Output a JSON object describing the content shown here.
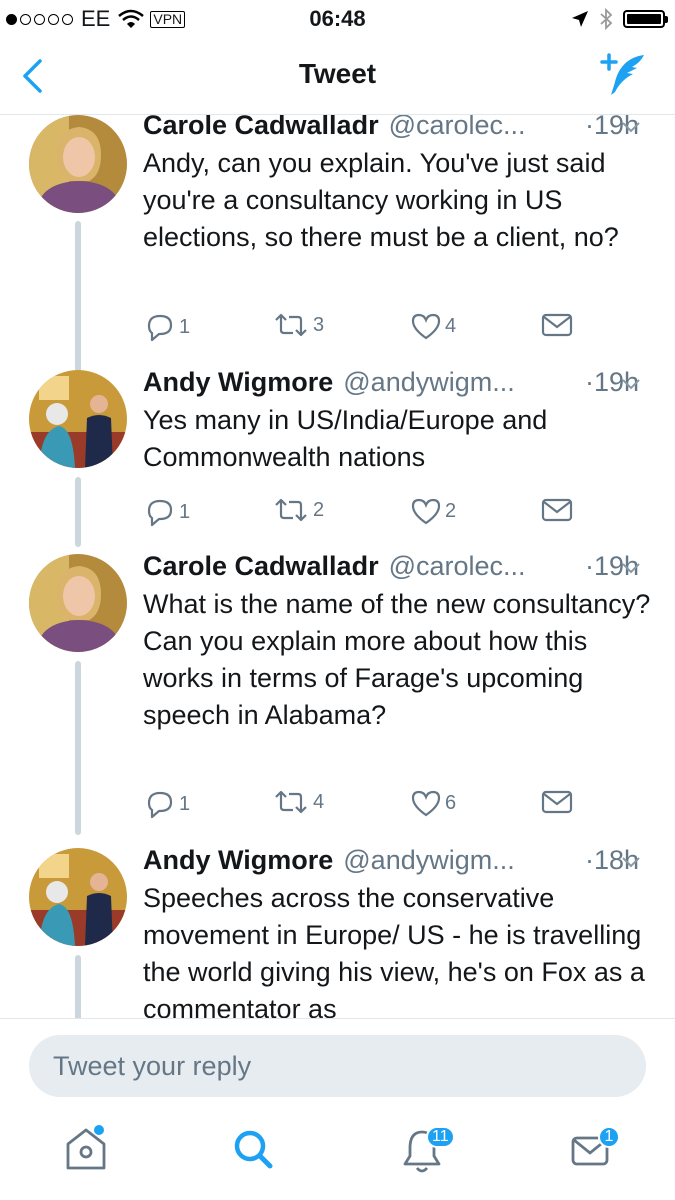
{
  "status_bar": {
    "carrier": "EE",
    "vpn": "VPN",
    "time": "06:48"
  },
  "nav": {
    "title": "Tweet"
  },
  "tweets": [
    {
      "name": "Carole Cadwalladr",
      "handle": "@carolec...",
      "time": "·19h",
      "text": "Andy, can you explain. You've just said you're a consultancy working in US elections, so there must be a client, no?",
      "replies": "1",
      "retweets": "3",
      "likes": "4"
    },
    {
      "name": "Andy Wigmore",
      "handle": "@andywigm...",
      "time": "·19h",
      "text": "Yes many in US/India/Europe and Commonwealth nations",
      "replies": "1",
      "retweets": "2",
      "likes": "2"
    },
    {
      "name": "Carole Cadwalladr",
      "handle": "@carolec...",
      "time": "·19h",
      "text": "What is the name of the new consultancy?\nCan you explain more about how this works in terms of Farage's upcoming speech in Alabama?",
      "replies": "1",
      "retweets": "4",
      "likes": "6"
    },
    {
      "name": "Andy Wigmore",
      "handle": "@andywigm...",
      "time": "·18h",
      "text": "Speeches across the conservative movement in Europe/ US - he is travelling the world giving his view, he's on Fox as a commentator as",
      "replies": "",
      "retweets": "",
      "likes": ""
    }
  ],
  "reply": {
    "placeholder": "Tweet your reply"
  },
  "tabbar": {
    "notifications_badge": "11",
    "messages_badge": "1"
  },
  "colors": {
    "accent": "#1da1f2",
    "gray": "#657786",
    "thread_line": "#ccd6dd"
  },
  "icons": [
    "back-chevron-icon",
    "compose-tweet-icon",
    "reply-icon",
    "retweet-icon",
    "like-icon",
    "direct-message-icon",
    "home-icon",
    "search-icon",
    "notifications-icon",
    "messages-icon"
  ]
}
